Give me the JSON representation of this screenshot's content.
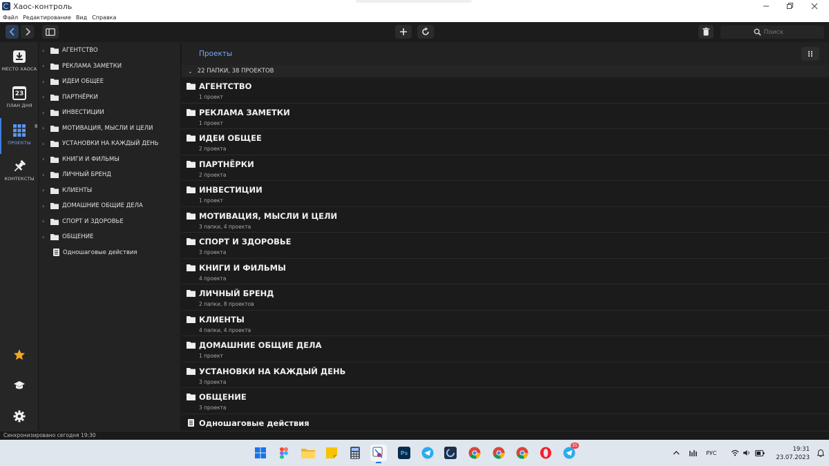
{
  "window": {
    "title": "Хаос-контроль",
    "controls": [
      "minimize-icon",
      "restore-icon",
      "close-icon"
    ]
  },
  "menu": [
    "Файл",
    "Редактирование",
    "Вид",
    "Справка"
  ],
  "toolbar": {
    "search_placeholder": "Поиск"
  },
  "rail": {
    "items": [
      {
        "label": "МЕСТО ХАОСА",
        "icon": "inbox-download-icon"
      },
      {
        "label": "ПЛАН ДНЯ",
        "icon": "calendar-icon",
        "day": "23",
        "badge": "8"
      },
      {
        "label": "ПРОЕКТЫ",
        "icon": "grid-icon",
        "active": true
      },
      {
        "label": "КОНТЕКСТЫ",
        "icon": "pin-icon"
      }
    ],
    "bottom": [
      "star-icon",
      "graduation-cap-icon",
      "settings-gear-icon"
    ]
  },
  "tree": {
    "folders": [
      "АГЕНТСТВО",
      "РЕКЛАМА ЗАМЕТКИ",
      "ИДЕИ ОБЩЕЕ",
      "ПАРТНЁРКИ",
      "ИНВЕСТИЦИИ",
      "МОТИВАЦИЯ, МЫСЛИ И ЦЕЛИ",
      "УСТАНОВКИ НА КАЖДЫЙ ДЕНЬ",
      "КНИГИ И ФИЛЬМЫ",
      "ЛИЧНЫЙ БРЕНД",
      "КЛИЕНТЫ",
      "ДОМАШНИЕ ОБЩИЕ ДЕЛА",
      "СПОРТ И ЗДОРОВЬЕ",
      "ОБЩЕНИЕ"
    ],
    "single_step": "Одношаговые действия"
  },
  "main": {
    "title": "Проекты",
    "summary": "22 ПАПКИ, 38 ПРОЕКТОВ",
    "rows": [
      {
        "name": "АГЕНТСТВО",
        "count": "1 проект"
      },
      {
        "name": "РЕКЛАМА ЗАМЕТКИ",
        "count": "1 проект"
      },
      {
        "name": "ИДЕИ ОБЩЕЕ",
        "count": "2 проекта"
      },
      {
        "name": "ПАРТНЁРКИ",
        "count": "2 проекта"
      },
      {
        "name": "ИНВЕСТИЦИИ",
        "count": "1 проект"
      },
      {
        "name": "МОТИВАЦИЯ, МЫСЛИ И ЦЕЛИ",
        "count": "3 папки, 4 проекта"
      },
      {
        "name": "СПОРТ И ЗДОРОВЬЕ",
        "count": "3 проекта"
      },
      {
        "name": "КНИГИ И ФИЛЬМЫ",
        "count": "4 проекта"
      },
      {
        "name": "ЛИЧНЫЙ БРЕНД",
        "count": "2 папки, 8 проектов"
      },
      {
        "name": "КЛИЕНТЫ",
        "count": "4 папки, 4 проекта"
      },
      {
        "name": "ДОМАШНИЕ ОБЩИЕ ДЕЛА",
        "count": "1 проект"
      },
      {
        "name": "УСТАНОВКИ НА КАЖДЫЙ ДЕНЬ",
        "count": "3 проекта"
      },
      {
        "name": "ОБЩЕНИЕ",
        "count": "3 проекта"
      }
    ],
    "single_step": "Одношаговые действия"
  },
  "status": {
    "text": "Синхронизировано сегодня 19:30"
  },
  "taskbar": {
    "apps": [
      "windows-start-icon",
      "figma-icon",
      "file-explorer-icon",
      "sticky-notes-icon",
      "calculator-icon",
      "snipping-tool-icon",
      "photoshop-icon",
      "telegram-icon",
      "chaos-control-icon",
      "chrome-icon",
      "chrome-icon",
      "chrome-icon",
      "opera-icon",
      "telegram-icon"
    ],
    "ps_label": "Ps",
    "telegram_badge": "35",
    "lang": "РУС",
    "time": "19:31",
    "date": "23.07.2023"
  }
}
